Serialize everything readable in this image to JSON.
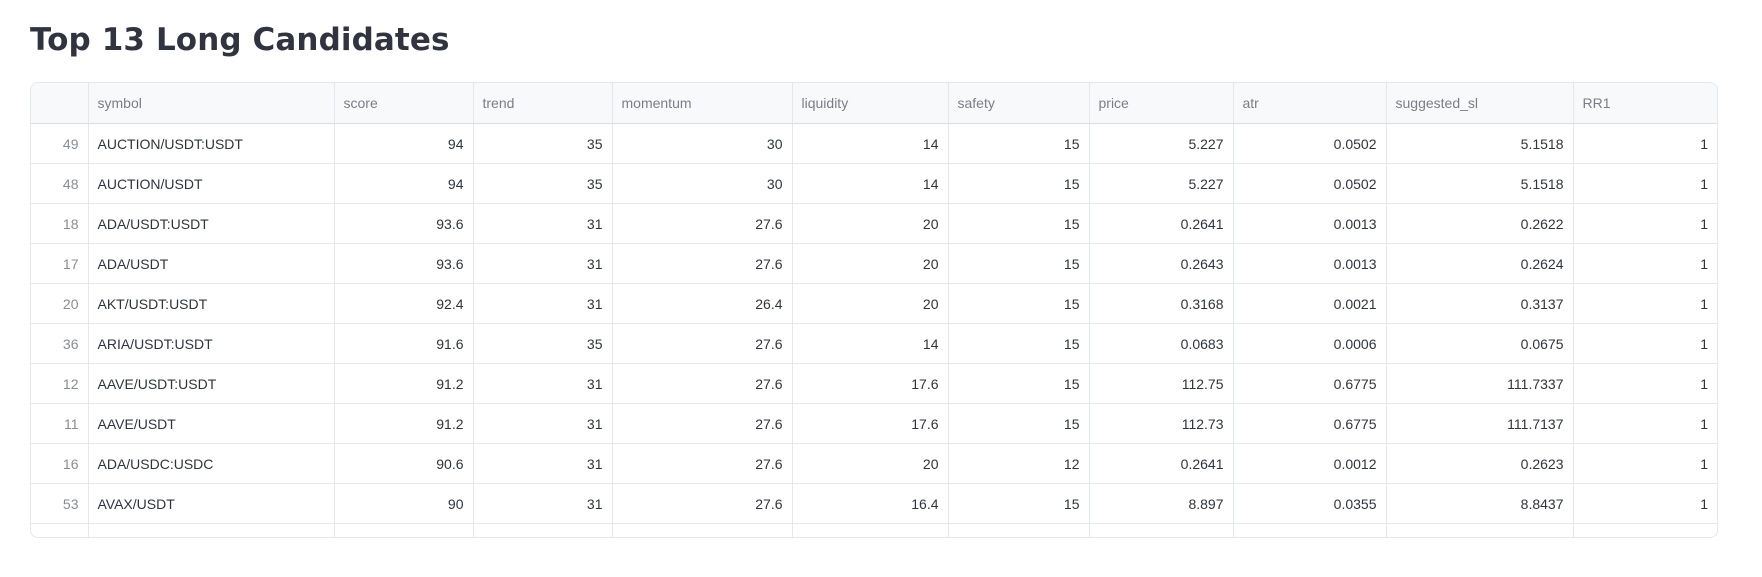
{
  "title": "Top 13 Long Candidates",
  "table": {
    "columns": [
      "",
      "symbol",
      "score",
      "trend",
      "momentum",
      "liquidity",
      "safety",
      "price",
      "atr",
      "suggested_sl",
      "RR1"
    ],
    "rows": [
      [
        "49",
        "AUCTION/USDT:USDT",
        "94",
        "35",
        "30",
        "14",
        "15",
        "5.227",
        "0.0502",
        "5.1518",
        "1"
      ],
      [
        "48",
        "AUCTION/USDT",
        "94",
        "35",
        "30",
        "14",
        "15",
        "5.227",
        "0.0502",
        "5.1518",
        "1"
      ],
      [
        "18",
        "ADA/USDT:USDT",
        "93.6",
        "31",
        "27.6",
        "20",
        "15",
        "0.2641",
        "0.0013",
        "0.2622",
        "1"
      ],
      [
        "17",
        "ADA/USDT",
        "93.6",
        "31",
        "27.6",
        "20",
        "15",
        "0.2643",
        "0.0013",
        "0.2624",
        "1"
      ],
      [
        "20",
        "AKT/USDT:USDT",
        "92.4",
        "31",
        "26.4",
        "20",
        "15",
        "0.3168",
        "0.0021",
        "0.3137",
        "1"
      ],
      [
        "36",
        "ARIA/USDT:USDT",
        "91.6",
        "35",
        "27.6",
        "14",
        "15",
        "0.0683",
        "0.0006",
        "0.0675",
        "1"
      ],
      [
        "12",
        "AAVE/USDT:USDT",
        "91.2",
        "31",
        "27.6",
        "17.6",
        "15",
        "112.75",
        "0.6775",
        "111.7337",
        "1"
      ],
      [
        "11",
        "AAVE/USDT",
        "91.2",
        "31",
        "27.6",
        "17.6",
        "15",
        "112.73",
        "0.6775",
        "111.7137",
        "1"
      ],
      [
        "16",
        "ADA/USDC:USDC",
        "90.6",
        "31",
        "27.6",
        "20",
        "12",
        "0.2641",
        "0.0012",
        "0.2623",
        "1"
      ],
      [
        "53",
        "AVAX/USDT",
        "90",
        "31",
        "27.6",
        "16.4",
        "15",
        "8.897",
        "0.0355",
        "8.8437",
        "1"
      ]
    ]
  }
}
